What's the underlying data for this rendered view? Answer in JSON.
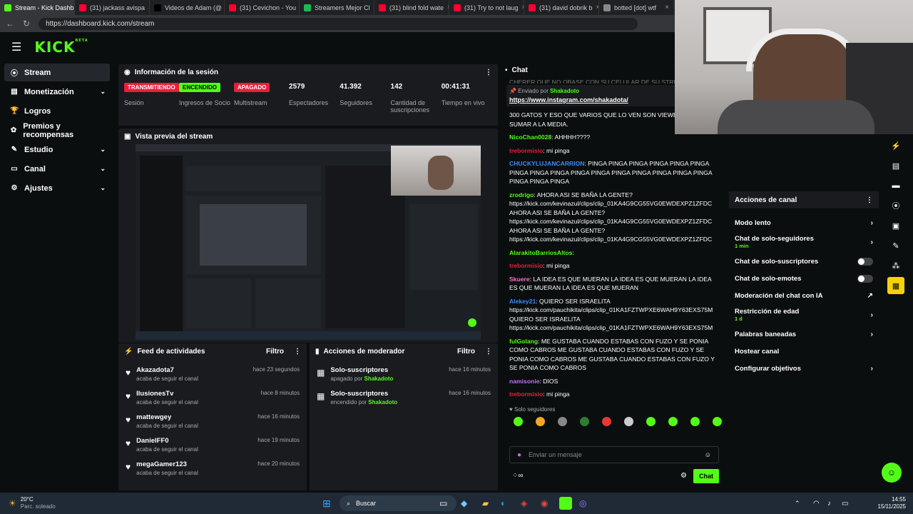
{
  "browser": {
    "tabs": [
      {
        "label": "Stream - Kick Dashb",
        "color": "#53fc18"
      },
      {
        "label": "(31) jackass avispa",
        "color": "#ff0033"
      },
      {
        "label": "Videos de Adam (@",
        "color": "#000000"
      },
      {
        "label": "(31) Cevichon - You",
        "color": "#ff0033"
      },
      {
        "label": "Streamers Mejor Cl",
        "color": "#1db954"
      },
      {
        "label": "(31) blind fold wate",
        "color": "#ff0033"
      },
      {
        "label": "(31) Try to not laug",
        "color": "#ff0033"
      },
      {
        "label": "(31) david dobrik b",
        "color": "#ff0033"
      },
      {
        "label": "botted [dot] wtf",
        "color": "#888888"
      }
    ],
    "url": "https://dashboard.kick.com/stream"
  },
  "header": {
    "logo": "KICK",
    "beta": "BETA"
  },
  "sidebar": {
    "items": [
      {
        "label": "Stream",
        "chevron": ""
      },
      {
        "label": "Monetización",
        "chevron": "⌄"
      },
      {
        "label": "Logros",
        "chevron": ""
      },
      {
        "label": "Premios y recompensas",
        "chevron": ""
      },
      {
        "label": "Estudio",
        "chevron": "⌄"
      },
      {
        "label": "Canal",
        "chevron": "⌄"
      },
      {
        "label": "Ajustes",
        "chevron": "⌄"
      }
    ]
  },
  "session": {
    "title": "Información de la sesión",
    "stats": [
      {
        "value": "TRANSMITIENDO",
        "label": "Sesión",
        "kind": "badge",
        "color": "#e91e3b",
        "textcolor": "#ffffff"
      },
      {
        "value": "ENCENDIDO",
        "label": "Ingresos de Socio",
        "kind": "badge",
        "color": "#53fc18",
        "textcolor": "#000000"
      },
      {
        "value": "APAGADO",
        "label": "Multistream",
        "kind": "badge",
        "color": "#e91e3b",
        "textcolor": "#ffffff"
      },
      {
        "value": "2579",
        "label": "Espectadores",
        "kind": "num"
      },
      {
        "value": "41.392",
        "label": "Seguidores",
        "kind": "num"
      },
      {
        "value": "142",
        "label": "Cantidad de suscripciones",
        "kind": "num"
      },
      {
        "value": "00:41:31",
        "label": "Tiempo en vivo",
        "kind": "num"
      }
    ]
  },
  "preview": {
    "title": "Vista previa del stream"
  },
  "feed": {
    "title": "Feed de actividades",
    "filter": "Filtro",
    "items": [
      {
        "name": "Akazadota7",
        "sub": "acaba de seguir el canal",
        "time": "hace 23 segundos"
      },
      {
        "name": "IlusionesTv",
        "sub": "acaba de seguir el canal",
        "time": "hace 8 minutos"
      },
      {
        "name": "mattewgey",
        "sub": "acaba de seguir el canal",
        "time": "hace 16 minutos"
      },
      {
        "name": "DanielFF0",
        "sub": "acaba de seguir el canal",
        "time": "hace 19 minutos"
      },
      {
        "name": "megaGamer123",
        "sub": "acaba de seguir el canal",
        "time": "hace 20 minutos"
      }
    ]
  },
  "modactions": {
    "title": "Acciones de moderador",
    "filter": "Filtro",
    "items": [
      {
        "name": "Solo-suscriptores",
        "sub_pre": "apagado por ",
        "by": "Shakadoto",
        "time": "hace 16 minutos"
      },
      {
        "name": "Solo-suscriptores",
        "sub_pre": "encendido por ",
        "by": "Shakadoto",
        "time": "hace 16 minutos"
      }
    ]
  },
  "chat": {
    "title": "Chat",
    "top_cut": "CHERER QUE NO OBASE CON SU CELULAR DE SU STREAM",
    "pinned_sent": "Enviado por",
    "pinned_user": "Shakadoto",
    "pinned_link": "https://www.instagram.com/shakadota/",
    "messages": [
      {
        "user": "",
        "color": "#ffffff",
        "text": "300 GATOS Y ESO QUE VARIOS QUE LO VEN SON VIEWERS NO VA A SUMAR A LA MEDIA."
      },
      {
        "user": "NicoChan0028",
        "color": "#53fc18",
        "text": ": AHHHH????"
      },
      {
        "user": "trebormisio",
        "color": "#e91e3b",
        "text": ": mi pinga"
      },
      {
        "user": "CHUCKYLUJANCARRION",
        "color": "#3b8bff",
        "text": ": PINGA PINGA PINGA PINGA PINGA PINGA PINGA PINGA PINGA PINGA PINGA PINGA PINGA PINGA PINGA PINGA PINGA PINGA PINGA"
      },
      {
        "user": "zrodrigo",
        "color": "#53fc18",
        "text": ": AHORA ASI SE BAÑA LA GENTE? https://kick.com/kevinazul/clips/clip_01KA4G9CG55VG0EWDEXPZ1ZFDC AHORA ASI SE BAÑA LA GENTE? https://kick.com/kevinazul/clips/clip_01KA4G9CG55VG0EWDEXPZ1ZFDC AHORA ASI SE BAÑA LA GENTE? https://kick.com/kevinazul/clips/clip_01KA4G9CG55VG0EWDEXPZ1ZFDC"
      },
      {
        "user": "AlarakitoBarriosAltos",
        "color": "#53fc18",
        "text": ":"
      },
      {
        "user": "trebormisio",
        "color": "#e91e3b",
        "text": ": mi pinga"
      },
      {
        "user": "Skuere",
        "color": "#ff6ec7",
        "text": ": LA IDEA ES QUE MUERAN LA IDEA ES QUE MUERAN LA IDEA ES QUE MUERAN LA IDEA ES QUE MUERAN"
      },
      {
        "user": "Alekey21",
        "color": "#3b8bff",
        "text": ": QUIERO SER ISRAELITA https://kick.com/pauchikita/clips/clip_01KA1FZTWPXE6WAH9Y63EXS75M QUIERO SER ISRAELITA https://kick.com/pauchikita/clips/clip_01KA1FZTWPXE6WAH9Y63EXS75M"
      },
      {
        "user": "fulGolang",
        "color": "#53fc18",
        "text": ": ME GUSTABA CUANDO ESTABAS CON FUZO Y SE PONIA COMO CABROS ME GUSTABA CUANDO ESTABAS CON FUZO Y SE PONIA COMO CABROS ME GUSTABA CUANDO ESTABAS CON FUZO Y SE PONIA COMO CABROS"
      },
      {
        "user": "namisonie",
        "color": "#c46bff",
        "text": ": DIOS"
      },
      {
        "user": "trebormisio",
        "color": "#e91e3b",
        "text": ": mi pinga"
      }
    ],
    "mode": "Solo seguidores",
    "placeholder": "Enviar un mensaje",
    "send": "Chat"
  },
  "channel_actions": {
    "title": "Acciones de canal",
    "items": [
      {
        "label": "Modo lento",
        "sub": "",
        "control": "›"
      },
      {
        "label": "Chat de solo-seguidores",
        "sub": "1 min",
        "control": "›"
      },
      {
        "label": "Chat de solo-suscriptores",
        "sub": "",
        "control": "toggle"
      },
      {
        "label": "Chat de solo-emotes",
        "sub": "",
        "control": "toggle"
      },
      {
        "label": "Moderación del chat con IA",
        "sub": "",
        "control": "↗"
      },
      {
        "label": "Restricción de edad",
        "sub": "1 d",
        "control": "›"
      },
      {
        "label": "Palabras baneadas",
        "sub": "",
        "control": "›"
      },
      {
        "label": "Hostear canal",
        "sub": "",
        "control": ""
      },
      {
        "label": "Configurar objetivos",
        "sub": "",
        "control": "›"
      }
    ]
  },
  "taskbar": {
    "weather_temp": "20°C",
    "weather_desc": "Parc. soleado",
    "search": "Buscar",
    "time": "14:55",
    "date": "15/11/2025"
  }
}
